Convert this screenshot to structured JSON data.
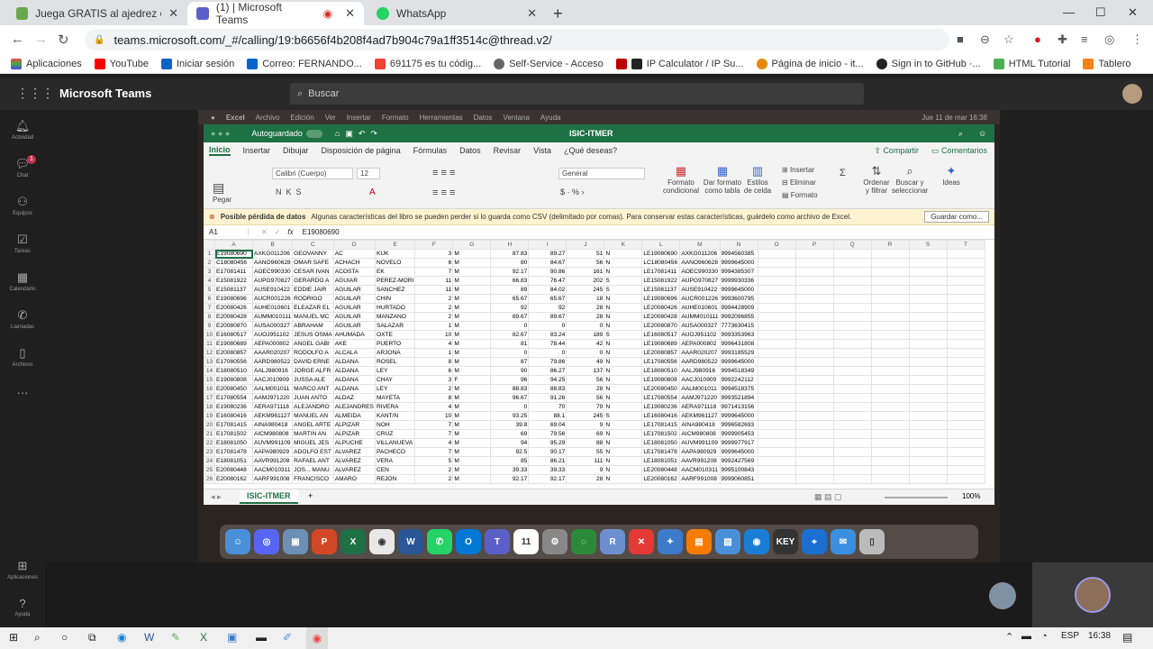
{
  "browser": {
    "tabs": [
      {
        "title": "Juega GRATIS al ajedrez online c",
        "color": "#6aa84f"
      },
      {
        "title": "(1) | Microsoft Teams",
        "color": "#5b5fc7"
      },
      {
        "title": "WhatsApp",
        "color": "#25d366"
      }
    ],
    "url": "teams.microsoft.com/_#/calling/19:b6656f4b208f4ad7b904c79a1ff3514c@thread.v2/",
    "bookmarks": [
      "Aplicaciones",
      "YouTube",
      "Iniciar sesión",
      "Correo: FERNANDO...",
      "691175 es tu códig...",
      "Self-Service - Acceso",
      "IP Calculator / IP Su...",
      "Página de inicio - it...",
      "Sign in to GitHub ·...",
      "HTML Tutorial",
      "Tablero"
    ]
  },
  "teams": {
    "app_title": "Microsoft Teams",
    "search_placeholder": "Buscar",
    "rail": [
      "Actividad",
      "Chat",
      "Equipos",
      "Tareas",
      "Calendario",
      "Llamadas",
      "Archivos",
      "Aplicaciones",
      "Ayuda"
    ],
    "chat_badge": "1"
  },
  "mac_menu": [
    "Excel",
    "Archivo",
    "Edición",
    "Ver",
    "Insertar",
    "Formato",
    "Herramientas",
    "Datos",
    "Ventana",
    "Ayuda"
  ],
  "mac_clock": "Jue 11 de mar  16:38",
  "excel": {
    "autosave": "Autoguardado",
    "doc_title": "ISIC-ITMER",
    "tabs": [
      "Inicio",
      "Insertar",
      "Dibujar",
      "Disposición de página",
      "Fórmulas",
      "Datos",
      "Revisar",
      "Vista",
      "¿Qué deseas?"
    ],
    "share": "Compartir",
    "comments": "Comentarios",
    "font": "Calibri (Cuerpo)",
    "font_size": "12",
    "number_format": "General",
    "paste": "Pegar",
    "ribbon_labels": [
      "Formato condicional",
      "Dar formato como tabla",
      "Estilos de celda",
      "Insertar",
      "Eliminar",
      "Formato",
      "Ordenar y filtrar",
      "Buscar y seleccionar",
      "Ideas"
    ],
    "warning_title": "Posible pérdida de datos",
    "warning_text": "Algunas características del libro se pueden perder si lo guarda como CSV (delimitado por comas). Para conservar estas características, guárdelo como archivo de Excel.",
    "warning_button": "Guardar como...",
    "cell_ref": "A1",
    "formula": "E19080690",
    "columns": [
      "A",
      "B",
      "C",
      "D",
      "E",
      "F",
      "G",
      "H",
      "I",
      "J",
      "K",
      "L",
      "M",
      "N",
      "O",
      "P",
      "Q",
      "R",
      "S",
      "T"
    ],
    "rows": [
      [
        "E19080690",
        "AXKG011206",
        "GEOVANNY",
        "AC",
        "KUK",
        "3",
        "M",
        "87.83",
        "89.27",
        "51",
        "N",
        "LE19080690",
        "AXKG011206",
        "9994560385"
      ],
      [
        "C18080456",
        "AANO960628",
        "OMAR SAFE",
        "ACHACH",
        "NOVELO",
        "6",
        "M",
        "80",
        "84.67",
        "56",
        "N",
        "LC18080456",
        "AANO960628",
        "9999645000"
      ],
      [
        "E17081411",
        "AOEC990330",
        "CESAR IVAN",
        "ACOSTA",
        "EK",
        "7",
        "M",
        "92.17",
        "90.86",
        "161",
        "N",
        "LE17081411",
        "AOEC990330",
        "9994385307"
      ],
      [
        "E15081922",
        "AUPG970827",
        "GERARDO A",
        "AGUIAR",
        "PEREZ-MORI",
        "11",
        "M",
        "66.83",
        "76.47",
        "202",
        "S",
        "LE15081922",
        "AUPG970827",
        "9999930336"
      ],
      [
        "E15081137",
        "AUSE910422",
        "EDDIE JAIR",
        "AGUILAR",
        "SANCHEZ",
        "11",
        "M",
        "89",
        "84.02",
        "245",
        "S",
        "LE15081137",
        "AUSE910422",
        "9999645000"
      ],
      [
        "E19080696",
        "AUCR001226",
        "RODRIGO",
        "AGUILAR",
        "CHIN",
        "2",
        "M",
        "65.67",
        "65.67",
        "18",
        "N",
        "LE19080696",
        "AUCR001226",
        "9993600795"
      ],
      [
        "E20080426",
        "AUHE010601",
        "ELEAZAR EL",
        "AGUILAR",
        "HURTADO",
        "2",
        "M",
        "92",
        "92",
        "28",
        "N",
        "LE20080426",
        "AUHE010601",
        "9994428909"
      ],
      [
        "E20080428",
        "AUMM010111",
        "MANUEL MC",
        "AGUILAR",
        "MANZANO",
        "2",
        "M",
        "89.67",
        "89.67",
        "28",
        "N",
        "LE20080428",
        "AUMM010111",
        "9992096855"
      ],
      [
        "E20080870",
        "AUSA000327",
        "ABRAHAM",
        "AGUILAR",
        "SALAZAR",
        "1",
        "M",
        "0",
        "0",
        "0",
        "N",
        "LE20080870",
        "AUSA000327",
        "7773630415"
      ],
      [
        "E16080517",
        "AUOJ951102",
        "JESUS OSMA",
        "AHUMADA",
        "OXTE",
        "10",
        "M",
        "82.67",
        "83.24",
        "189",
        "S",
        "LE16080517",
        "AUOJ951102",
        "9993353963"
      ],
      [
        "E19080689",
        "AEPA000802",
        "ANGEL GABI",
        "AKE",
        "PUERTO",
        "4",
        "M",
        "81",
        "78.44",
        "42",
        "N",
        "LE19080689",
        "AEPA000802",
        "9996431808"
      ],
      [
        "E20080857",
        "AAAR020207",
        "RODOLFO A",
        "ALCALA",
        "ARJONA",
        "1",
        "M",
        "0",
        "0",
        "0",
        "N",
        "LE20080857",
        "AAAR020207",
        "9993185529"
      ],
      [
        "E17080556",
        "AARD980522",
        "DAVID ERNE",
        "ALDANA",
        "ROSEL",
        "8",
        "M",
        "87",
        "79.86",
        "49",
        "N",
        "LE17080556",
        "AARD980522",
        "9999645000"
      ],
      [
        "E18080510",
        "AALJ980916",
        "JORGE ALFR",
        "ALDANA",
        "LEY",
        "6",
        "M",
        "90",
        "86.27",
        "137",
        "N",
        "LE18080510",
        "AALJ980916",
        "9994518349"
      ],
      [
        "E19080808",
        "AACJ010909",
        "JUSSA ALE",
        "ALDANA",
        "CHAY",
        "3",
        "F",
        "96",
        "94.25",
        "56",
        "N",
        "LE19080808",
        "AACJ010909",
        "9992242112"
      ],
      [
        "E20080450",
        "AALM001011",
        "MARCO ANT",
        "ALDANA",
        "LEY",
        "2",
        "M",
        "88.83",
        "88.83",
        "28",
        "N",
        "LE20080450",
        "AALM001011",
        "9994518375"
      ],
      [
        "E17080554",
        "AAMJ971220",
        "JUAN ANTO",
        "ALDAZ",
        "MAYETA",
        "8",
        "M",
        "96.67",
        "91.26",
        "56",
        "N",
        "LE17080554",
        "AAMJ971220",
        "9993521894"
      ],
      [
        "E19080236",
        "AERA971118",
        "ALEJANDRO",
        "ALEJANDRES",
        "RIVERA",
        "4",
        "M",
        "0",
        "70",
        "79",
        "N",
        "LE19080236",
        "AERA971118",
        "9971413156"
      ],
      [
        "E16080416",
        "AEKM961127",
        "MANUEL AN",
        "ALMEIDA",
        "KANT/N",
        "10",
        "M",
        "93.25",
        "88.1",
        "245",
        "S",
        "LE16080416",
        "AEKM961127",
        "9999645000"
      ],
      [
        "E17081415",
        "AINA980418",
        "ANGEL ARTE",
        "ALPIZAR",
        "NOH",
        "7",
        "M",
        "39.8",
        "69.04",
        "9",
        "N",
        "LE17081415",
        "AINA980418",
        "9996582693"
      ],
      [
        "E17081502",
        "AICM980808",
        "MARTIN AN",
        "ALPIZAR",
        "CRUZ",
        "7",
        "M",
        "69",
        "79.56",
        "69",
        "N",
        "LE17081502",
        "AICM980808",
        "9999905453"
      ],
      [
        "E18081050",
        "AUVM991109",
        "MIGUEL JES",
        "ALPUCHE",
        "VILLANUEVA",
        "4",
        "M",
        "94",
        "95.29",
        "88",
        "N",
        "LE18081050",
        "AUVM991109",
        "9999977917"
      ],
      [
        "E17081478",
        "AAPA980929",
        "ADOLFO EST",
        "ALVAREZ",
        "PACHECO",
        "7",
        "M",
        "92.5",
        "90.17",
        "55",
        "N",
        "LE17081478",
        "AAPA980929",
        "9999645000"
      ],
      [
        "E18081051",
        "AAVR991208",
        "RAFAEL ANT",
        "ALVAREZ",
        "VERA",
        "5",
        "M",
        "85",
        "86.21",
        "111",
        "N",
        "LE18081051",
        "AAVR991208",
        "9992427569"
      ],
      [
        "E20080448",
        "AACM010311",
        "JOS... MANU",
        "ALVAREZ",
        "CEN",
        "2",
        "M",
        "39.33",
        "39.33",
        "9",
        "N",
        "LE20080448",
        "AACM010311",
        "9995100843"
      ],
      [
        "E20080162",
        "AARF991008",
        "FRANCISCO",
        "AMARO",
        "REJON",
        "2",
        "M",
        "92.17",
        "92.17",
        "28",
        "N",
        "LE20080162",
        "AARF991008",
        "9999060851"
      ]
    ],
    "sheet_tab": "ISIC-ITMER",
    "zoom": "100%"
  },
  "dock_apps": [
    "Finder",
    "Discord",
    "Preview",
    "PowerPoint",
    "Excel",
    "Chrome",
    "Word",
    "WhatsApp",
    "Outlook",
    "Teams",
    "Calendar",
    "Settings",
    "Activity",
    "R",
    "Remote",
    "Xcode",
    "Pages",
    "Preview",
    "Edge",
    "Keynote",
    "Codepoint",
    "Mail",
    "Trash"
  ],
  "taskbar": {
    "lang": "ESP",
    "time": "16:38"
  }
}
